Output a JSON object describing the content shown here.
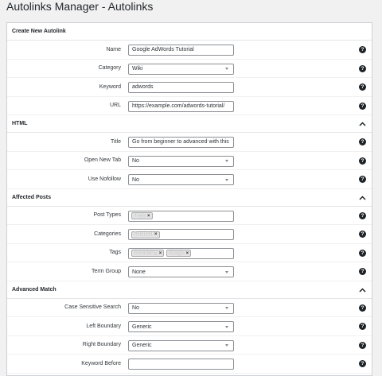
{
  "page": {
    "title": "Autolinks Manager - Autolinks"
  },
  "sections": [
    {
      "title": "Create New Autolink",
      "collapsible": false,
      "rows": [
        {
          "label": "Name",
          "type": "text",
          "value": "Google AdWords Tutorial"
        },
        {
          "label": "Category",
          "type": "select",
          "value": "Wiki"
        },
        {
          "label": "Keyword",
          "type": "text",
          "value": "adwords"
        },
        {
          "label": "URL",
          "type": "text",
          "value": "https://example.com/adwords-tutorial/"
        }
      ]
    },
    {
      "title": "HTML",
      "collapsible": true,
      "rows": [
        {
          "label": "Title",
          "type": "text",
          "value": "Go from beginner to advanced with this"
        },
        {
          "label": "Open New Tab",
          "type": "select",
          "value": "No"
        },
        {
          "label": "Use Nofollow",
          "type": "select",
          "value": "No"
        }
      ]
    },
    {
      "title": "Affected Posts",
      "collapsible": true,
      "rows": [
        {
          "label": "Post Types",
          "type": "chips",
          "chips": [
            "Posts"
          ]
        },
        {
          "label": "Categories",
          "type": "chips",
          "chips": [
            "Financial"
          ]
        },
        {
          "label": "Tags",
          "type": "chips",
          "chips": [
            "Advertising",
            "Google"
          ]
        },
        {
          "label": "Term Group",
          "type": "select",
          "value": "None"
        }
      ]
    },
    {
      "title": "Advanced Match",
      "collapsible": true,
      "rows": [
        {
          "label": "Case Sensitive Search",
          "type": "select",
          "value": "No"
        },
        {
          "label": "Left Boundary",
          "type": "select",
          "value": "Generic"
        },
        {
          "label": "Right Boundary",
          "type": "select",
          "value": "Generic"
        },
        {
          "label": "Keyword Before",
          "type": "text",
          "value": ""
        }
      ]
    }
  ],
  "icons": {
    "help": "?",
    "collapse": "chevron-up-icon",
    "dropdown": "chevron-down-icon"
  }
}
